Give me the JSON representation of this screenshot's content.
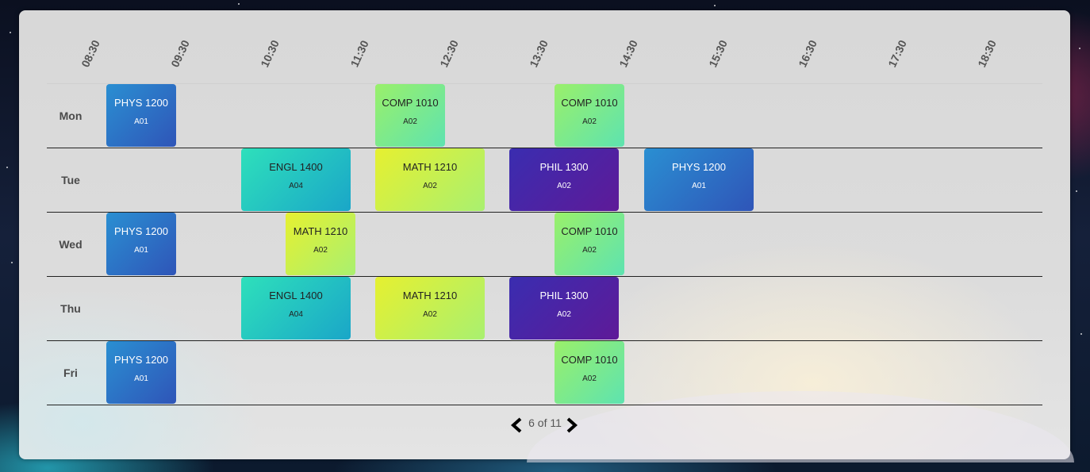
{
  "times": [
    "08:30",
    "09:30",
    "10:30",
    "11:30",
    "12:30",
    "13:30",
    "14:30",
    "15:30",
    "16:30",
    "17:30",
    "18:30"
  ],
  "days": [
    "Mon",
    "Tue",
    "Wed",
    "Thu",
    "Fri"
  ],
  "courses": {
    "mon": [
      {
        "name": "PHYS 1200",
        "section": "A01"
      },
      {
        "name": "COMP 1010",
        "section": "A02"
      },
      {
        "name": "COMP 1010",
        "section": "A02"
      }
    ],
    "tue": [
      {
        "name": "ENGL 1400",
        "section": "A04"
      },
      {
        "name": "MATH 1210",
        "section": "A02"
      },
      {
        "name": "PHIL 1300",
        "section": "A02"
      },
      {
        "name": "PHYS 1200",
        "section": "A01"
      }
    ],
    "wed": [
      {
        "name": "PHYS 1200",
        "section": "A01"
      },
      {
        "name": "MATH 1210",
        "section": "A02"
      },
      {
        "name": "COMP 1010",
        "section": "A02"
      }
    ],
    "thu": [
      {
        "name": "ENGL 1400",
        "section": "A04"
      },
      {
        "name": "MATH 1210",
        "section": "A02"
      },
      {
        "name": "PHIL 1300",
        "section": "A02"
      }
    ],
    "fri": [
      {
        "name": "PHYS 1200",
        "section": "A01"
      },
      {
        "name": "COMP 1010",
        "section": "A02"
      }
    ]
  },
  "pager": {
    "text": "6 of 11"
  },
  "colors": {
    "phys": "#2a8fd2",
    "comp": "#9af06a",
    "engl": "#2ee0bb",
    "math": "#e6f030",
    "phil": "#3a2db0"
  }
}
